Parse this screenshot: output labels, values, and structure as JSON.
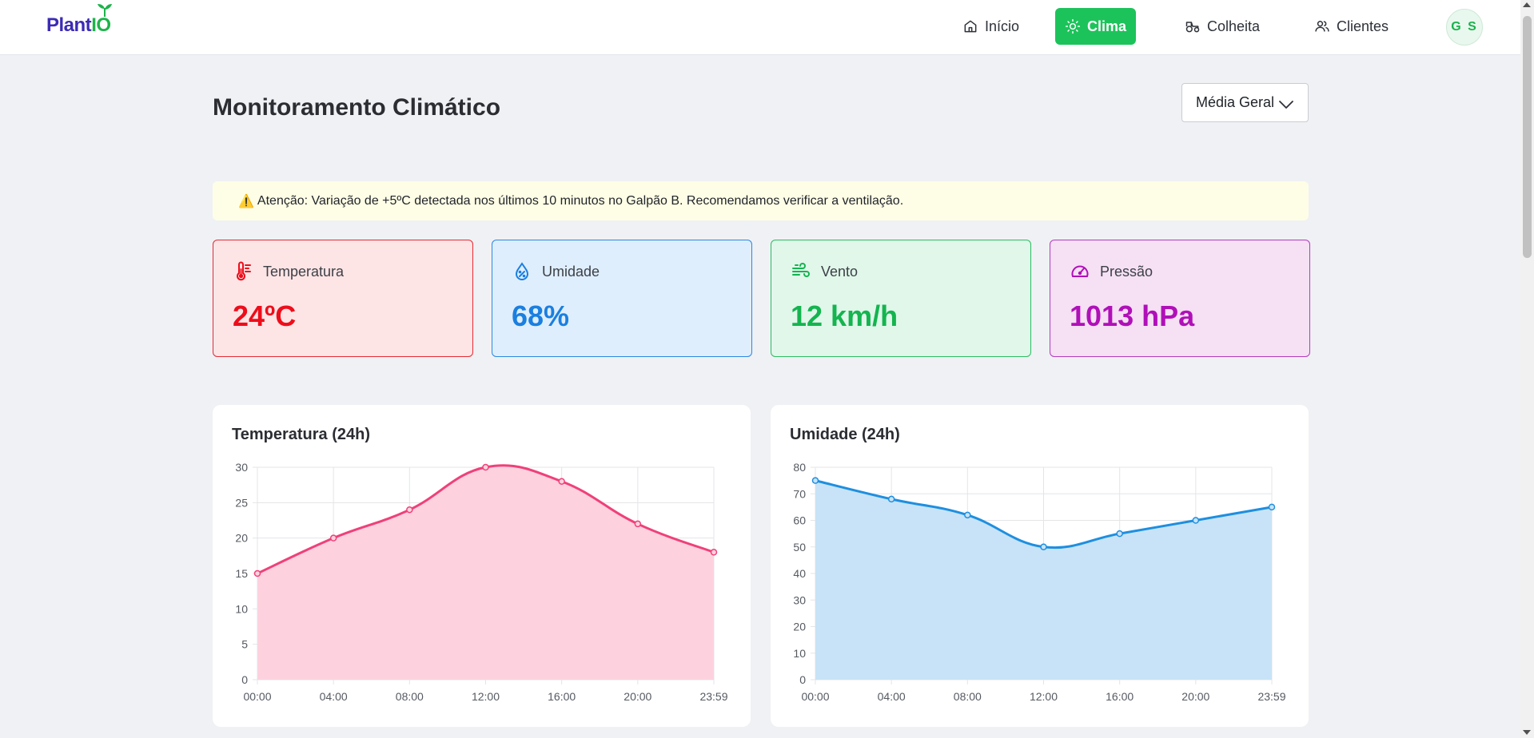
{
  "app": {
    "logo": {
      "part1": "Plant",
      "part2": "IO"
    },
    "nav": [
      {
        "label": "Início",
        "icon": "home-icon",
        "active": false
      },
      {
        "label": "Clima",
        "icon": "sun-icon",
        "active": true
      },
      {
        "label": "Colheita",
        "icon": "tractor-icon",
        "active": false
      },
      {
        "label": "Clientes",
        "icon": "users-icon",
        "active": false
      }
    ],
    "avatar": "G S"
  },
  "page": {
    "title": "Monitoramento Climático",
    "location_select": "Média Geral",
    "alert": "Atenção: Variação de +5ºC detectada nos últimos 10 minutos no Galpão B. Recomendamos verificar a ventilação."
  },
  "metrics": [
    {
      "label": "Temperatura",
      "value": "24ºC",
      "icon": "thermometer-icon",
      "color": "#ee0d1a"
    },
    {
      "label": "Umidade",
      "value": "68%",
      "icon": "droplet-percent-icon",
      "color": "#1a7fe0"
    },
    {
      "label": "Vento",
      "value": "12 km/h",
      "icon": "wind-icon",
      "color": "#14b44f"
    },
    {
      "label": "Pressão",
      "value": "1013 hPa",
      "icon": "gauge-icon",
      "color": "#b010b8"
    }
  ],
  "colors": {
    "accent": "#1cc35a",
    "temp_line": "#f0407a",
    "temp_fill": "#fdd2de",
    "hum_line": "#1e8fe0",
    "hum_fill": "#c8e3f7"
  },
  "chart_data": [
    {
      "type": "area",
      "title": "Temperatura (24h)",
      "x": [
        "00:00",
        "04:00",
        "08:00",
        "12:00",
        "16:00",
        "20:00",
        "23:59"
      ],
      "series": [
        {
          "values": [
            15,
            20,
            24,
            30,
            28,
            22,
            18
          ]
        }
      ],
      "ylim": [
        0,
        30
      ],
      "yticks": [
        0,
        5,
        10,
        15,
        20,
        25,
        30
      ],
      "grid": true,
      "legend": "none"
    },
    {
      "type": "area",
      "title": "Umidade (24h)",
      "x": [
        "00:00",
        "04:00",
        "08:00",
        "12:00",
        "16:00",
        "20:00",
        "23:59"
      ],
      "series": [
        {
          "values": [
            75,
            68,
            62,
            50,
            55,
            60,
            65
          ]
        }
      ],
      "ylim": [
        0,
        80
      ],
      "yticks": [
        0,
        10,
        20,
        30,
        40,
        50,
        60,
        70,
        80
      ],
      "grid": true,
      "legend": "none"
    }
  ]
}
